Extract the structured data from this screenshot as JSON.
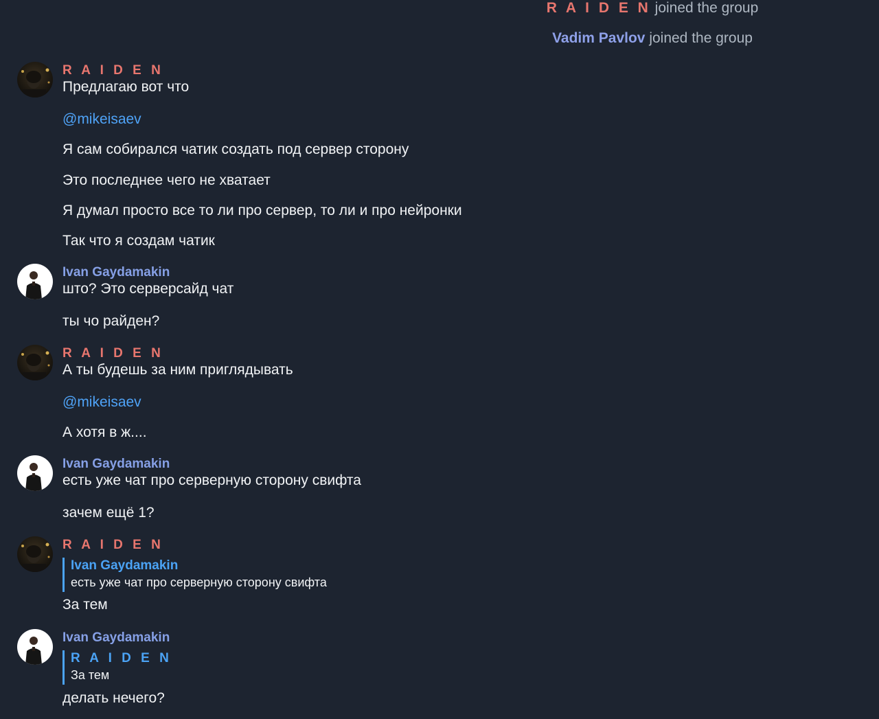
{
  "service_messages": [
    {
      "name": "R A I D E N",
      "action": "joined the group"
    },
    {
      "name": "Vadim Pavlov",
      "action": "joined the group"
    }
  ],
  "messages": [
    {
      "sender": "R A I D E N",
      "lines": [
        "Предлагаю вот что",
        "@mikeisaev",
        "Я сам собирался чатик создать под сервер сторону",
        "Это последнее чего не хватает",
        "Я думал просто все то ли про сервер, то ли и про нейронки",
        "Так что я создам чатик"
      ]
    },
    {
      "sender": "Ivan Gaydamakin",
      "lines": [
        "што? Это серверсайд чат",
        "ты чо райден?"
      ]
    },
    {
      "sender": "R A I D E N",
      "lines": [
        "А ты будешь за ним приглядывать",
        "@mikeisaev",
        "А хотя в ж...."
      ]
    },
    {
      "sender": "Ivan Gaydamakin",
      "lines": [
        "есть уже чат про серверную сторону свифта",
        "зачем ещё 1?"
      ]
    },
    {
      "sender": "R A I D E N",
      "reply": {
        "name": "Ivan Gaydamakin",
        "text": "есть уже чат про серверную сторону свифта"
      },
      "lines": [
        "За тем"
      ]
    },
    {
      "sender": "Ivan Gaydamakin",
      "reply": {
        "name": "R A I D E N",
        "text": "За тем"
      },
      "lines": [
        "делать нечего?"
      ]
    }
  ]
}
